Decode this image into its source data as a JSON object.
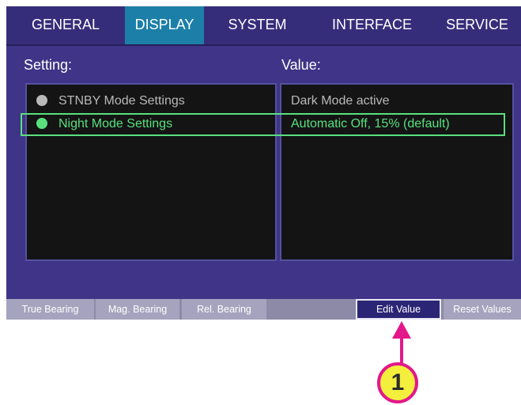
{
  "tabs": [
    {
      "label": "GENERAL"
    },
    {
      "label": "DISPLAY"
    },
    {
      "label": "SYSTEM"
    },
    {
      "label": "INTERFACE"
    },
    {
      "label": "SERVICE"
    }
  ],
  "active_tab": "DISPLAY",
  "headers": {
    "setting": "Setting:",
    "value": "Value:"
  },
  "rows": [
    {
      "setting": "STNBY Mode Settings",
      "value": "Dark Mode active",
      "status_color": "#b9b9b9",
      "selected": false
    },
    {
      "setting": "Night Mode Settings",
      "value": "Automatic Off, 15% (default)",
      "status_color": "#58e07e",
      "selected": true
    }
  ],
  "softkeys": [
    {
      "label": "True Bearing"
    },
    {
      "label": "Mag. Bearing"
    },
    {
      "label": "Rel. Bearing"
    },
    {
      "label": "Edit Value"
    },
    {
      "label": "Reset Values"
    }
  ],
  "callout": {
    "label": "1"
  },
  "colors": {
    "accent_tab": "#1c7fa7",
    "selection": "#58e07e",
    "callout_fill": "#f4ef3c",
    "callout_border": "#e3188b"
  }
}
